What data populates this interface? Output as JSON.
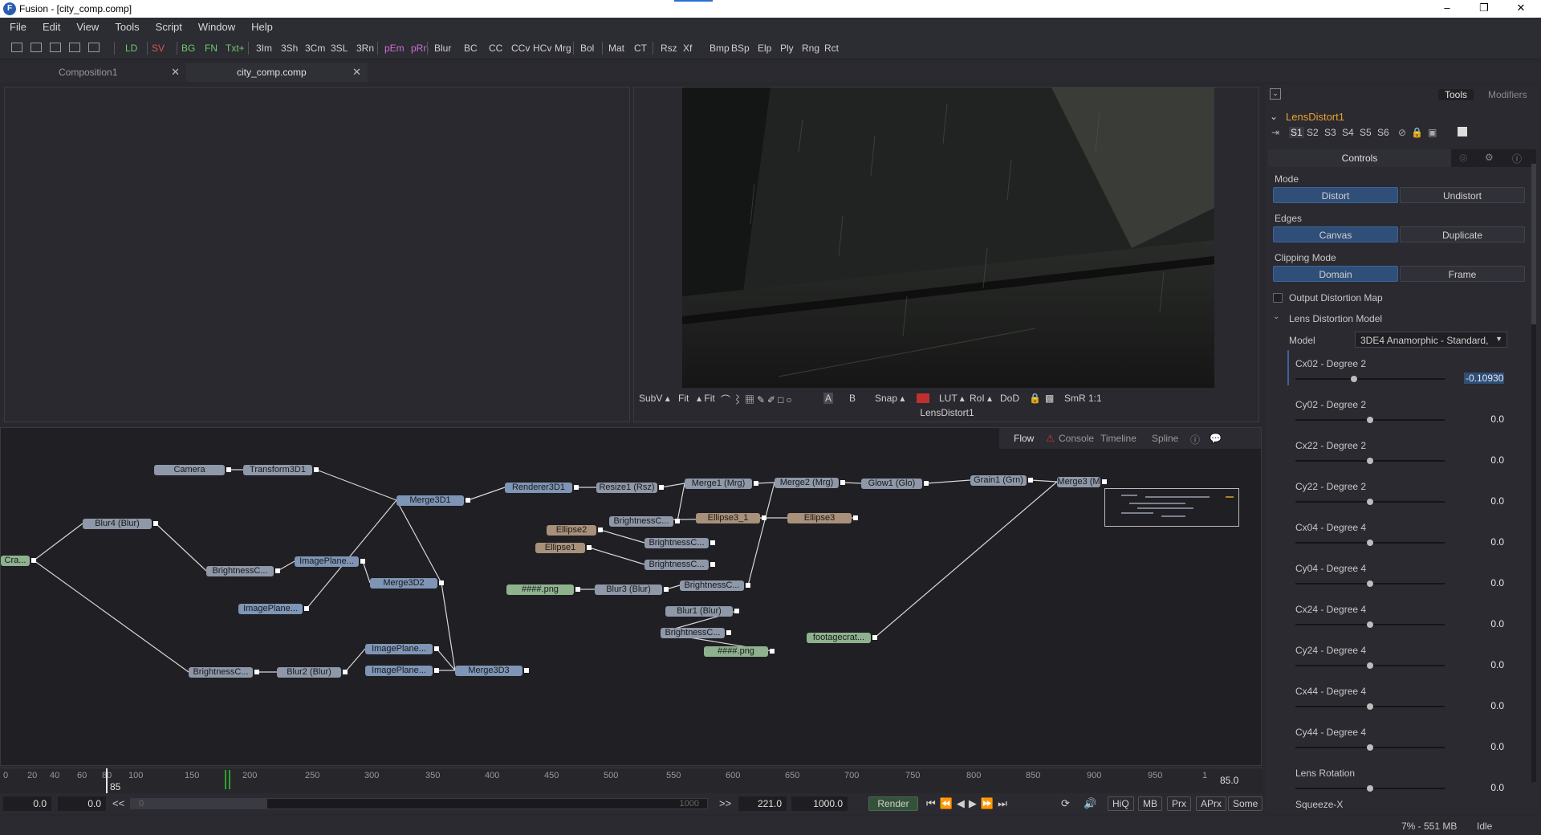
{
  "window": {
    "title": "Fusion - [city_comp.comp]",
    "minimize": "–",
    "maximize": "❐",
    "close": "✕"
  },
  "menu": [
    "File",
    "Edit",
    "View",
    "Tools",
    "Script",
    "Window",
    "Help"
  ],
  "toolbar": {
    "tools": [
      "LD",
      "SV",
      "BG",
      "FN",
      "Txt+",
      "3Im",
      "3Sh",
      "3Cm",
      "3SL",
      "3Rn",
      "pEm",
      "pRn",
      "Blur",
      "BC",
      "CC",
      "CCv",
      "HCv",
      "Mrg",
      "Bol",
      "Mat",
      "CT",
      "Rsz",
      "Xf",
      "Bmp",
      "BSp",
      "Elp",
      "Ply",
      "Rng",
      "Rct"
    ],
    "colors": {
      "LD": "#6ecb6e",
      "SV": "#e05252",
      "BG": "#6ecb6e",
      "FN": "#6ecb6e",
      "Txt+": "#6ecb6e",
      "pEm": "#d36ed3",
      "pRn": "#d36ed3"
    }
  },
  "tabs": [
    {
      "label": "Composition1",
      "close": "✕"
    },
    {
      "label": "city_comp.comp",
      "close": "✕"
    }
  ],
  "viewer2": {
    "toolbar": [
      "SubV ▴",
      "Fit",
      "▴ Fit",
      "A",
      "B",
      "Snap ▴",
      "LUT ▴",
      "RoI ▴",
      "DoD",
      "SmR",
      "1:1"
    ],
    "label": "LensDistort1"
  },
  "flow": {
    "tabs": [
      "Flow",
      "Console",
      "Timeline",
      "Spline"
    ],
    "nodes": [
      {
        "label": "Camera",
        "color": "gray"
      },
      {
        "label": "Transform3D1",
        "color": "gray"
      },
      {
        "label": "Merge3D1",
        "color": "blue"
      },
      {
        "label": "Renderer3D1",
        "color": "blue"
      },
      {
        "label": "Resize1 (Rsz)",
        "color": "gray"
      },
      {
        "label": "Merge1 (Mrg)",
        "color": "gray"
      },
      {
        "label": "Merge2 (Mrg)",
        "color": "gray"
      },
      {
        "label": "Glow1 (Glo)",
        "color": "gray"
      },
      {
        "label": "Grain1 (Grn)",
        "color": "gray"
      },
      {
        "label": "Merge3 (M",
        "color": "gray"
      },
      {
        "label": "Blur4 (Blur)",
        "color": "gray"
      },
      {
        "label": "Cra...",
        "color": "green"
      },
      {
        "label": "BrightnessC...",
        "color": "gray"
      },
      {
        "label": "ImagePlane...",
        "color": "blue"
      },
      {
        "label": "Merge3D2",
        "color": "blue"
      },
      {
        "label": "ImagePlane...",
        "color": "blue"
      },
      {
        "label": "BrightnessC...",
        "color": "gray"
      },
      {
        "label": "Blur2 (Blur)",
        "color": "gray"
      },
      {
        "label": "ImagePlane...",
        "color": "blue"
      },
      {
        "label": "ImagePlane...",
        "color": "blue"
      },
      {
        "label": "Merge3D3",
        "color": "blue"
      },
      {
        "label": "BrightnessC...",
        "color": "gray"
      },
      {
        "label": "Ellipse3_1",
        "color": "brown"
      },
      {
        "label": "Ellipse3",
        "color": "brown"
      },
      {
        "label": "Ellipse2",
        "color": "brown"
      },
      {
        "label": "BrightnessC...",
        "color": "gray"
      },
      {
        "label": "Ellipse1",
        "color": "brown"
      },
      {
        "label": "BrightnessC...",
        "color": "gray"
      },
      {
        "label": "####.png",
        "color": "green"
      },
      {
        "label": "Blur3 (Blur)",
        "color": "gray"
      },
      {
        "label": "BrightnessC...",
        "color": "gray"
      },
      {
        "label": "Blur1 (Blur)",
        "color": "gray"
      },
      {
        "label": "BrightnessC...",
        "color": "gray"
      },
      {
        "label": "####.png",
        "color": "green"
      },
      {
        "label": "footagecrat...",
        "color": "green"
      }
    ]
  },
  "timeline": {
    "ticks": [
      "0",
      "20",
      "40",
      "60",
      "80",
      "100",
      "150",
      "200",
      "250",
      "300",
      "350",
      "400",
      "450",
      "500",
      "550",
      "600",
      "650",
      "700",
      "750",
      "800",
      "850",
      "900",
      "950",
      "1"
    ],
    "current_frame": "85",
    "end_display": "85.0"
  },
  "transport": {
    "start": "0.0",
    "global_start": "0.0",
    "back": "<<",
    "range_start": "0",
    "range_end": "1000",
    "forward": ">>",
    "render_end": "221.0",
    "global_end": "1000.0",
    "render": "Render",
    "hiq": "HiQ",
    "mb": "MB",
    "prx": "Prx",
    "aprx": "APrx",
    "some": "Some"
  },
  "status": {
    "memory": "7% - 551 MB",
    "state": "Idle"
  },
  "inspector": {
    "tabs": [
      "Tools",
      "Modifiers"
    ],
    "tool_name": "LensDistort1",
    "subtabs": [
      "S1",
      "S2",
      "S3",
      "S4",
      "S5",
      "S6"
    ],
    "controls_tab": "Controls",
    "mode_label": "Mode",
    "mode_options": [
      "Distort",
      "Undistort"
    ],
    "edges_label": "Edges",
    "edges_options": [
      "Canvas",
      "Duplicate"
    ],
    "clipping_label": "Clipping Mode",
    "clipping_options": [
      "Domain",
      "Frame"
    ],
    "output_map_label": "Output Distortion Map",
    "lens_model_label": "Lens Distortion Model",
    "model_label": "Model",
    "model_value": "3DE4 Anamorphic - Standard,",
    "sliders": [
      {
        "label": "Cx02 - Degree 2",
        "value": "-0.10930",
        "pos": 0.39
      },
      {
        "label": "Cy02 - Degree 2",
        "value": "0.0",
        "pos": 0.5
      },
      {
        "label": "Cx22 - Degree 2",
        "value": "0.0",
        "pos": 0.5
      },
      {
        "label": "Cy22 - Degree 2",
        "value": "0.0",
        "pos": 0.5
      },
      {
        "label": "Cx04 - Degree 4",
        "value": "0.0",
        "pos": 0.5
      },
      {
        "label": "Cy04 - Degree 4",
        "value": "0.0",
        "pos": 0.5
      },
      {
        "label": "Cx24 - Degree 4",
        "value": "0.0",
        "pos": 0.5
      },
      {
        "label": "Cy24 - Degree 4",
        "value": "0.0",
        "pos": 0.5
      },
      {
        "label": "Cx44 - Degree 4",
        "value": "0.0",
        "pos": 0.5
      },
      {
        "label": "Cy44 - Degree 4",
        "value": "0.0",
        "pos": 0.5
      },
      {
        "label": "Lens Rotation",
        "value": "0.0",
        "pos": 0.5
      }
    ],
    "last_label": "Squeeze-X"
  }
}
